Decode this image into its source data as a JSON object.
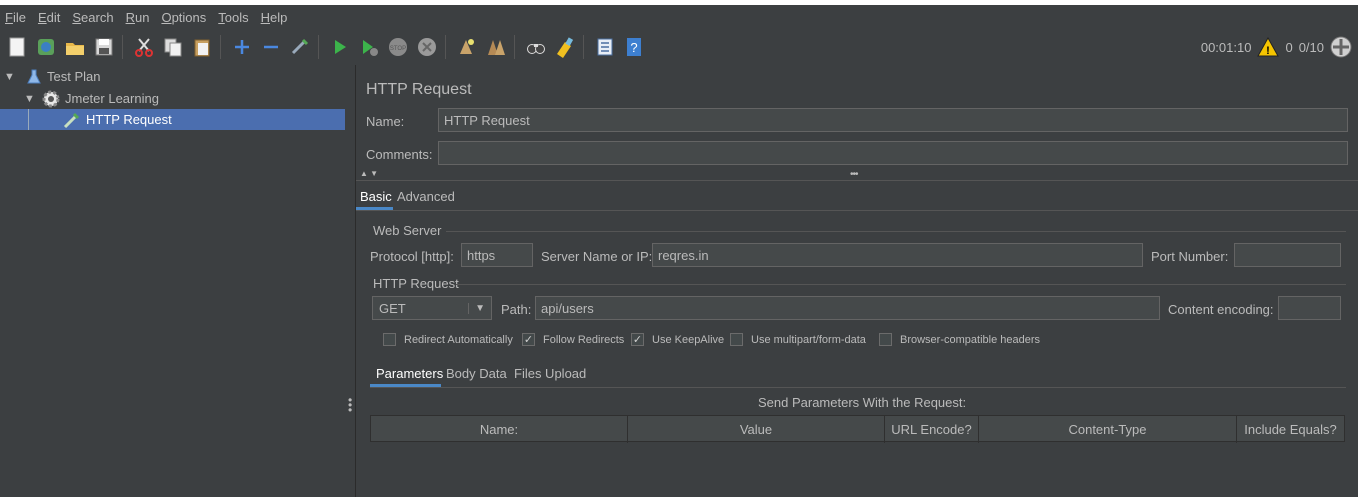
{
  "menu": [
    "File",
    "Edit",
    "Search",
    "Run",
    "Options",
    "Tools",
    "Help"
  ],
  "menu_mnemonic": [
    "F",
    "E",
    "S",
    "R",
    "O",
    "T",
    "H"
  ],
  "toolbar_status": {
    "timer": "00:01:10",
    "warnings": "0",
    "threads": "0/10"
  },
  "tree": {
    "items": [
      {
        "label": "Test Plan",
        "icon": "flask-icon"
      },
      {
        "label": "Jmeter Learning",
        "icon": "gear-icon"
      },
      {
        "label": "HTTP Request",
        "icon": "pipette-icon"
      }
    ]
  },
  "panel": {
    "title": "HTTP Request",
    "name_label": "Name:",
    "name_value": "HTTP Request",
    "comments_label": "Comments:",
    "comments_value": "",
    "tabs": [
      "Basic",
      "Advanced"
    ],
    "web_server": {
      "section": "Web Server",
      "protocol_label": "Protocol [http]:",
      "protocol_value": "https",
      "server_label": "Server Name or IP:",
      "server_value": "reqres.in",
      "port_label": "Port Number:",
      "port_value": ""
    },
    "http_request": {
      "section": "HTTP Request",
      "method": "GET",
      "path_label": "Path:",
      "path_value": "api/users",
      "encoding_label": "Content encoding:",
      "encoding_value": ""
    },
    "options": [
      {
        "label": "Redirect Automatically",
        "checked": false
      },
      {
        "label": "Follow Redirects",
        "checked": true
      },
      {
        "label": "Use KeepAlive",
        "checked": true
      },
      {
        "label": "Use multipart/form-data",
        "checked": false
      },
      {
        "label": "Browser-compatible headers",
        "checked": false
      }
    ],
    "subtabs": [
      "Parameters",
      "Body Data",
      "Files Upload"
    ],
    "params_caption": "Send Parameters With the Request:",
    "columns": [
      "Name:",
      "Value",
      "URL Encode?",
      "Content-Type",
      "Include Equals?"
    ]
  }
}
